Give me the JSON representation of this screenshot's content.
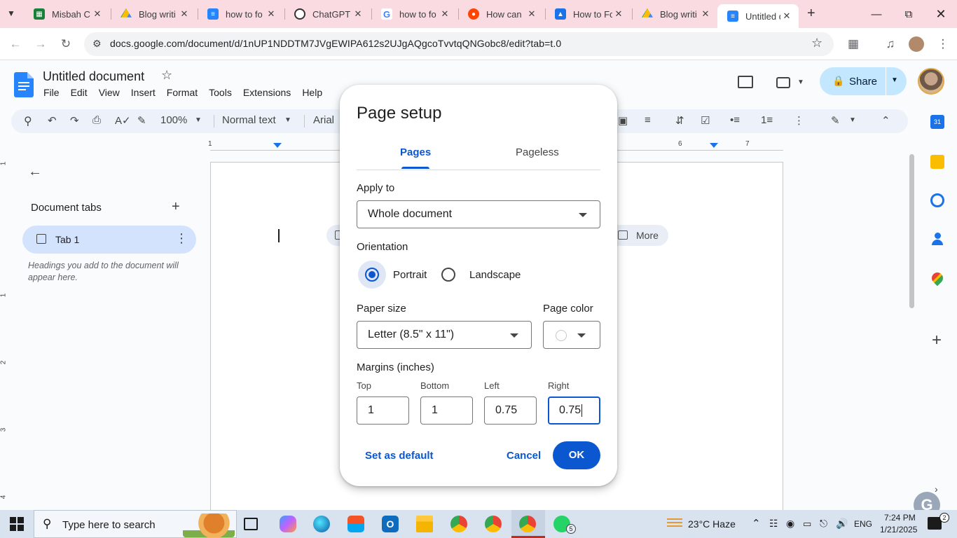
{
  "browser": {
    "tabs": [
      {
        "title": "Misbah C",
        "favicon": "sheets-icon",
        "color": "#188038"
      },
      {
        "title": "Blog writi",
        "favicon": "drive-icon",
        "color": "#1a73e8"
      },
      {
        "title": "how to fo",
        "favicon": "docs-icon",
        "color": "#2684fc"
      },
      {
        "title": "ChatGPT",
        "favicon": "chatgpt-icon",
        "color": "#333333"
      },
      {
        "title": "how to fo",
        "favicon": "google-icon",
        "color": "#4285f4"
      },
      {
        "title": "How can",
        "favicon": "reddit-icon",
        "color": "#ff4500"
      },
      {
        "title": "How to Fo",
        "favicon": "site-icon",
        "color": "#1a73e8"
      },
      {
        "title": "Blog writi",
        "favicon": "drive-icon",
        "color": "#1a73e8"
      },
      {
        "title": "Untitled d",
        "favicon": "docs-icon",
        "color": "#2684fc"
      }
    ],
    "url": "docs.google.com/document/d/1nUP1NDDTM7JVgEWIPA612s2UJgAQgcoTvvtqQNGobc8/edit?tab=t.0"
  },
  "docs": {
    "title": "Untitled document",
    "menu": [
      "File",
      "Edit",
      "View",
      "Insert",
      "Format",
      "Tools",
      "Extensions",
      "Help"
    ],
    "zoom": "100%",
    "style": "Normal text",
    "font": "Arial",
    "share_label": "Share",
    "more_label": "More"
  },
  "ruler": [
    "1",
    "6",
    "7"
  ],
  "vruler": [
    "1",
    "1",
    "2",
    "3",
    "4"
  ],
  "sidebar": {
    "title": "Document tabs",
    "tab_label": "Tab 1",
    "hint": "Headings you add to the document will appear here."
  },
  "dialog": {
    "title": "Page setup",
    "tab_pages": "Pages",
    "tab_pageless": "Pageless",
    "apply_to_label": "Apply to",
    "apply_to_value": "Whole document",
    "orientation_label": "Orientation",
    "portrait": "Portrait",
    "landscape": "Landscape",
    "paper_size_label": "Paper size",
    "paper_size_value": "Letter (8.5\" x 11\")",
    "page_color_label": "Page color",
    "margins_label": "Margins (inches)",
    "margins": {
      "top_label": "Top",
      "top": "1",
      "bottom_label": "Bottom",
      "bottom": "1",
      "left_label": "Left",
      "left": "0.75",
      "right_label": "Right",
      "right": "0.75"
    },
    "set_default": "Set as default",
    "cancel": "Cancel",
    "ok": "OK"
  },
  "taskbar": {
    "search_placeholder": "Type here to search",
    "weather": "23°C  Haze",
    "lang": "ENG",
    "time": "7:24 PM",
    "date": "1/21/2025",
    "notif_count": "2",
    "whatsapp_badge": "5"
  }
}
